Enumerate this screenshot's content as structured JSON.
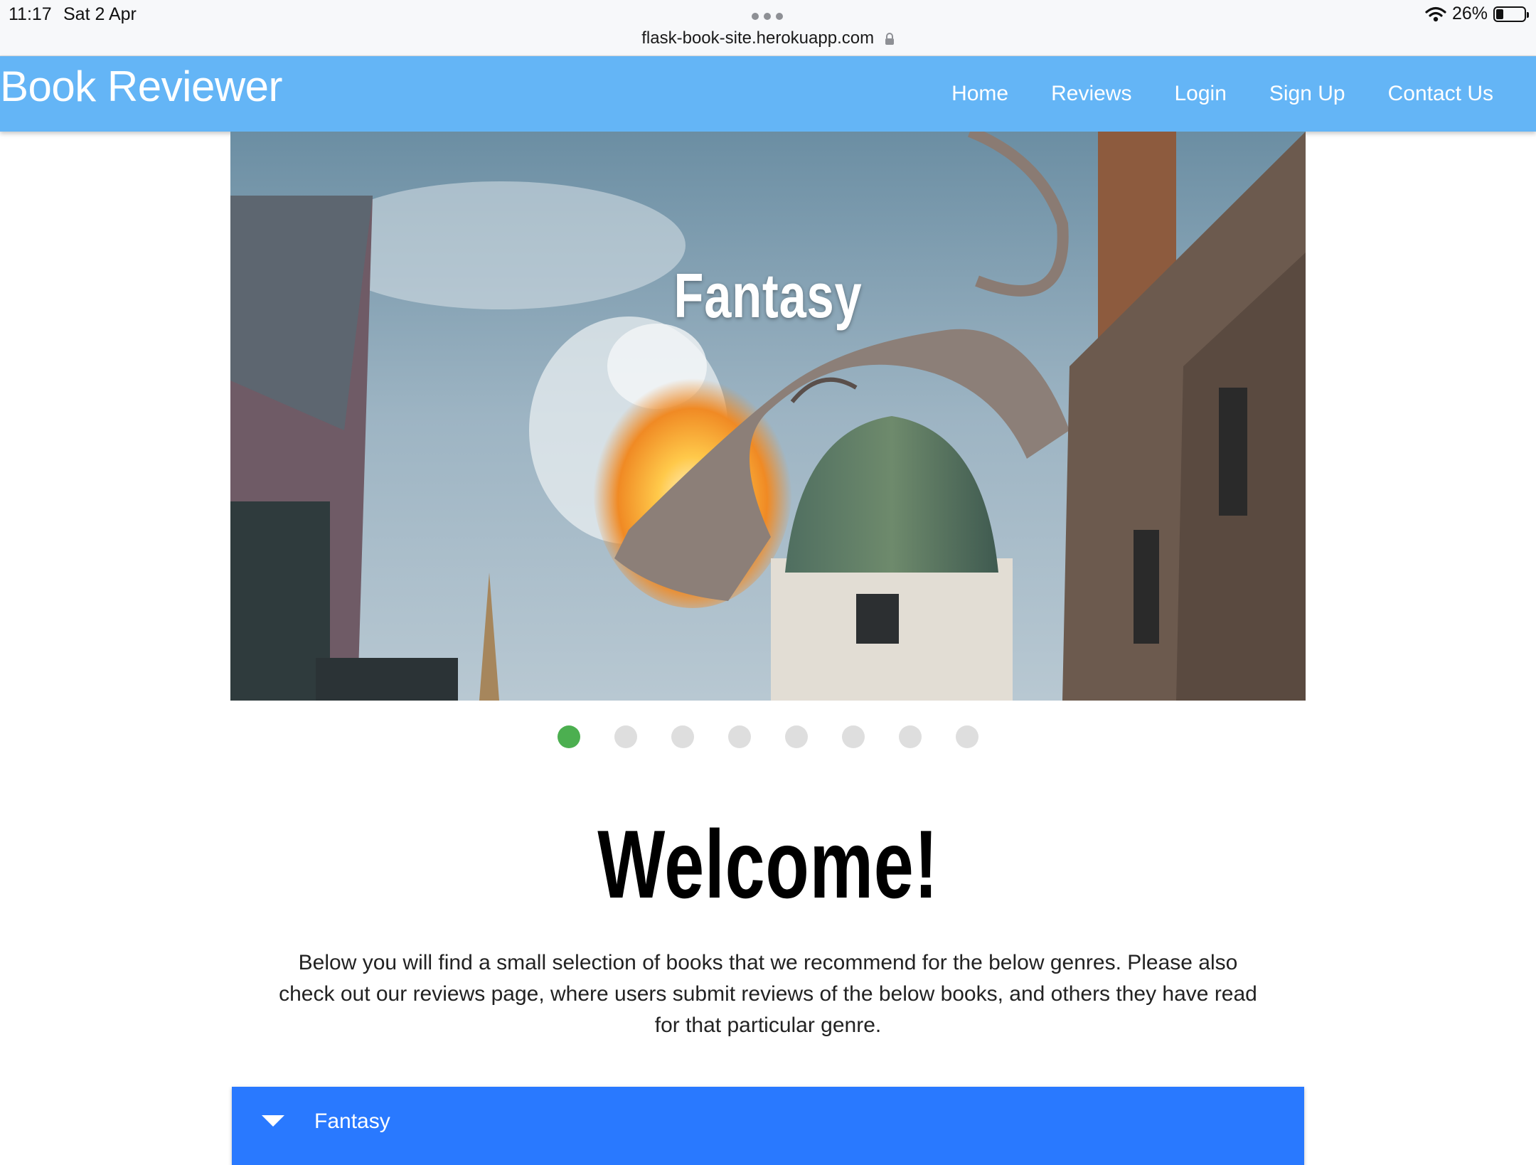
{
  "status_bar": {
    "time": "11:17",
    "date": "Sat 2 Apr",
    "url": "flask-book-site.herokuapp.com",
    "battery_percent": "26%",
    "battery_level": 0.26,
    "icons": [
      "wifi-icon",
      "battery-icon",
      "lock-icon",
      "more-dots-icon"
    ]
  },
  "navbar": {
    "brand": "Book Reviewer",
    "links": [
      "Home",
      "Reviews",
      "Login",
      "Sign Up",
      "Contact Us"
    ],
    "color": "#64b5f6"
  },
  "carousel": {
    "caption": "Fantasy",
    "slide_count": 8,
    "active_index": 0,
    "active_color": "#4caf50",
    "inactive_color": "#dedede"
  },
  "welcome": {
    "heading": "Welcome!",
    "intro": "Below you will find a small selection of books that we recommend for the below genres. Please also check out our reviews page, where users submit reviews of the below books, and others they have read for that particular genre."
  },
  "collapsible": {
    "label": "Fantasy",
    "icon": "arrow-drop-down-icon",
    "color": "#2979ff"
  }
}
